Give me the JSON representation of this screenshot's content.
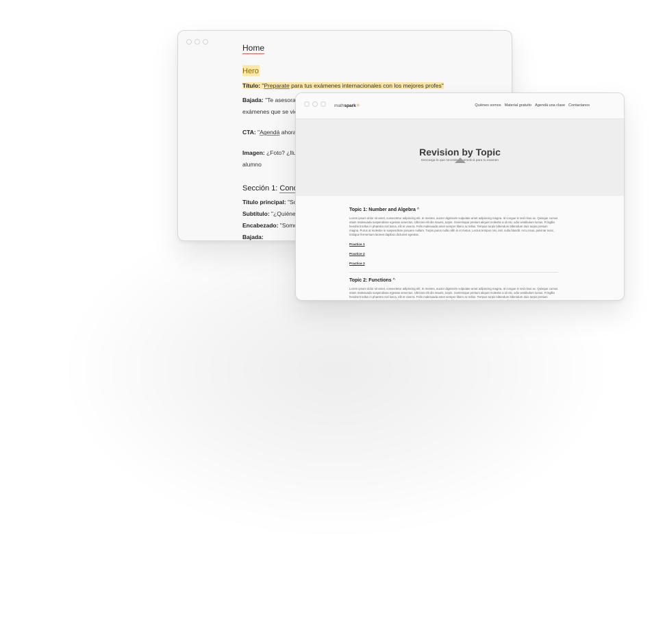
{
  "doc": {
    "heading_home": "Home",
    "heading_hero": "Hero",
    "titulo_label": "Título:",
    "titulo_quote_open": "\"",
    "titulo_link": "Preparate",
    "titulo_rest": " para tus exámenes internacionales con los mejores profes\"",
    "bajada_label": "Bajada:",
    "bajada_text": "\"Te asesoramos e",
    "bajada_cont": "exámenes que se viene",
    "cta_label": "CTA:",
    "cta_quote_open": " \"",
    "cta_link": "Agendá",
    "cta_rest": " ahora\" | \"",
    "imagen_label": "Imagen:",
    "imagen_text": " ¿Foto? ¿Ilustra",
    "imagen_cont": "alumno",
    "section1_prefix": "Sección 1: ",
    "section1_link": "Conoc",
    "titulo_principal_label": "Titulo principal:",
    "titulo_principal_text": " \"Sobre",
    "subtitulo_label": "Subtítulo:",
    "subtitulo_text": " \"¿Quiénes s",
    "encabezado_label": "Encabezado:",
    "encabezado_text": " \"Somos u",
    "bajada2_label": "Bajada:"
  },
  "site": {
    "logo_prefix": "math",
    "logo_bold": "spark",
    "nav": [
      "Quiénes somos",
      "Material gratuito",
      "Agendá una clase",
      "Contactanos"
    ],
    "hero_title": "Revision by Topic",
    "hero_sub": "Descarga lo que necesites y practicá para tu examen",
    "topic1_title": "Topic 1: Number and Algebra",
    "topic1_chevron": "^",
    "lorem": "Lorem ipsum dolor sit amet, consectetur adipiscing elit. In montes, auctor dignissim vulputate amet adipiscing magna. Id congue in sed risus ac. Quisque cursus etiam malesuada suspendisse egestas senectus. Ultricies elit dis mauris, turpis. Scelerisque pretium aliquet molestie a id nisi, odio vestibulum luctus. Fringilla hendrerit tellus in pharetra nisl lusca, elit et viverra. Felis malesuada amet semper libero ac tellus. Tempus turpis bibendum bibendum duis turpis pretium magna. Purus at molestie in suspendisse posuere nullam. Turpis purus nulla nibh in et metus. Lectus tempus nisi, nisl, nulla blandit. Arcu risus, pulvinar nunc, tristique fermentum laoreet dapibus dictumst egestas.",
    "practice": [
      "Practice 1",
      "Practice 2",
      "Practice 3"
    ],
    "topic2_title": "Topic 2: Functions",
    "topic2_chevron": "^"
  }
}
